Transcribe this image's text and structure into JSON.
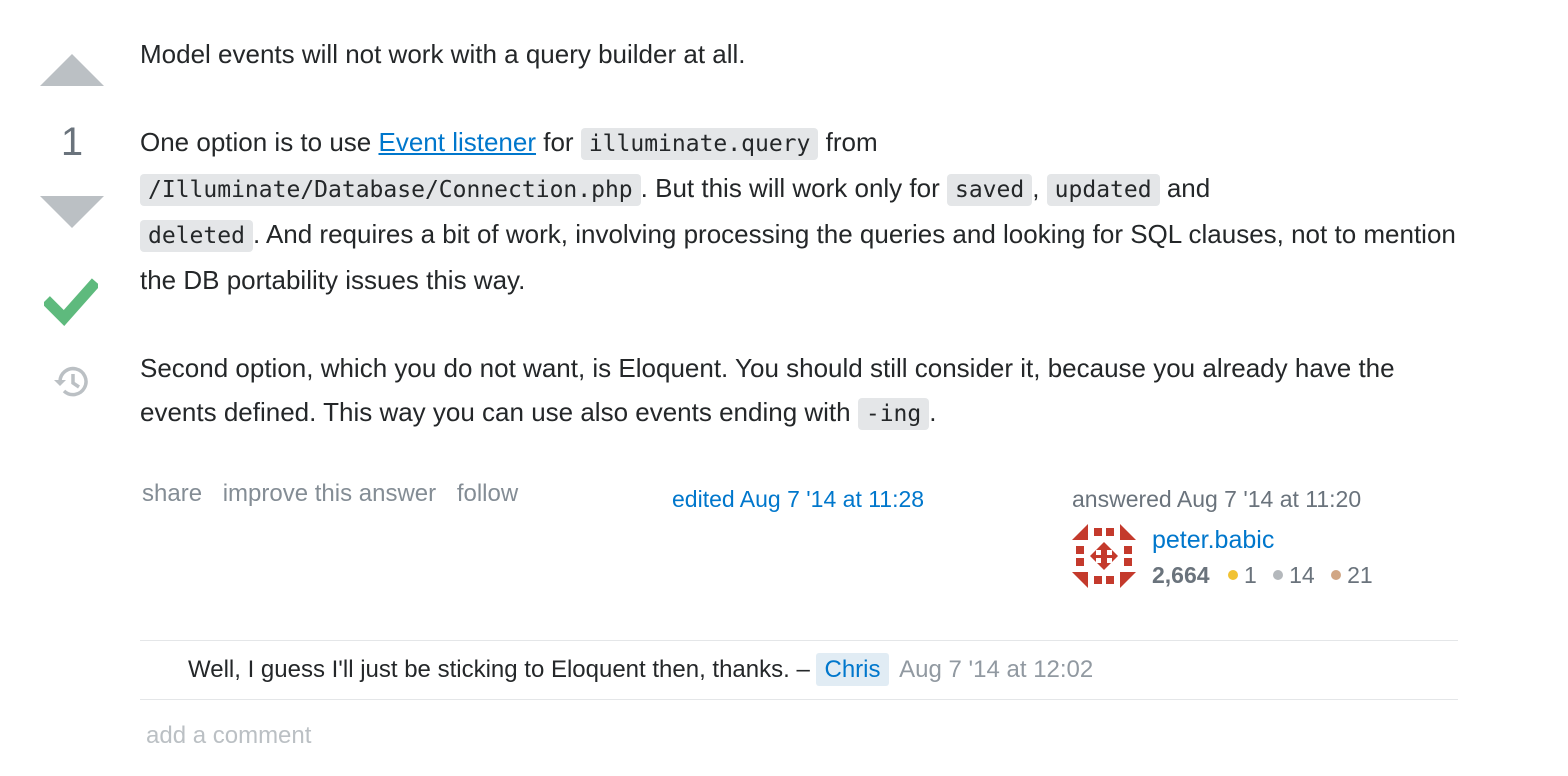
{
  "vote": {
    "count": "1"
  },
  "post": {
    "p1": "Model events will not work with a query builder at all.",
    "p2_a": "One option is to use ",
    "p2_link": "Event listener",
    "p2_b": " for ",
    "p2_code1": "illuminate.query",
    "p2_c": " from ",
    "p2_code2": "/Illuminate/Database/Connection.php",
    "p2_d": ". But this will work only for ",
    "p2_code3": "saved",
    "p2_e": ", ",
    "p2_code4": "updated",
    "p2_f": " and ",
    "p2_code5": "deleted",
    "p2_g": ". And requires a bit of work, involving processing the queries and looking for SQL clauses, not to mention the DB portability issues this way.",
    "p3_a": "Second option, which you do not want, is Eloquent. You should still consider it, because you already have the events defined. This way you can use also events ending with ",
    "p3_code": "-ing",
    "p3_b": "."
  },
  "menu": {
    "share": "share",
    "improve": "improve this answer",
    "follow": "follow"
  },
  "edited": "edited Aug 7 '14 at 11:28",
  "owner": {
    "answered": "answered Aug 7 '14 at 11:20",
    "name": "peter.babic",
    "reputation": "2,664",
    "gold": "1",
    "silver": "14",
    "bronze": "21",
    "badge_colors": {
      "gold": "#f1c232",
      "silver": "#b4b8bc",
      "bronze": "#d1a684"
    },
    "avatar_color": "#c43a2c"
  },
  "comments": [
    {
      "text": "Well, I guess I'll just be sticking to Eloquent then, thanks. – ",
      "user": "Chris",
      "date": "Aug 7 '14 at 12:02"
    }
  ],
  "add_comment": "add a comment"
}
